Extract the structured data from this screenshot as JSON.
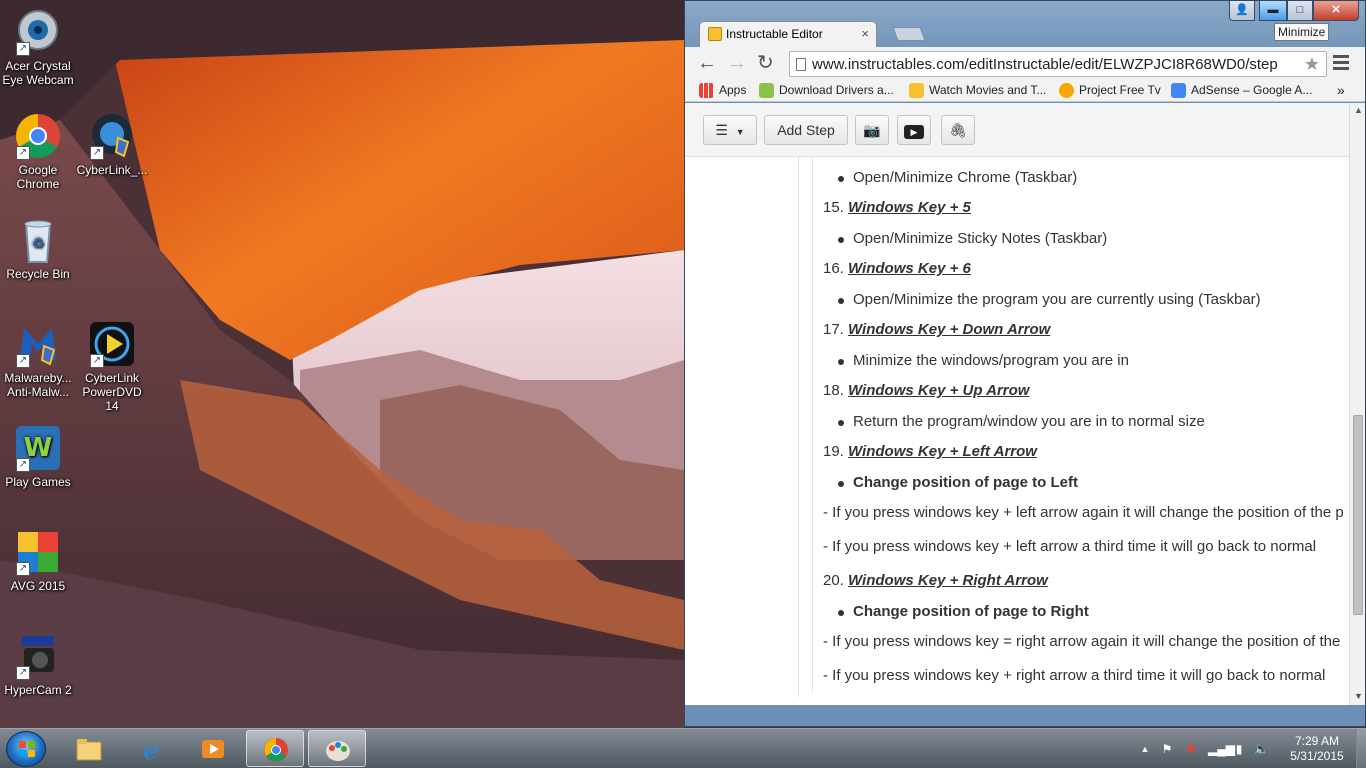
{
  "desktop": {
    "icons": [
      {
        "label": "Acer Crystal Eye Webcam"
      },
      {
        "label": "Google Chrome"
      },
      {
        "label": "CyberLink_..."
      },
      {
        "label": "Recycle Bin"
      },
      {
        "label": "Malwareby... Anti-Malw..."
      },
      {
        "label": "CyberLink PowerDVD 14"
      },
      {
        "label": "Play Games"
      },
      {
        "label": "AVG 2015"
      },
      {
        "label": "HyperCam 2"
      }
    ]
  },
  "browser": {
    "tab_title": "Instructable Editor",
    "tab_close": "×",
    "tooltip": "Minimize",
    "url": "www.instructables.com/editInstructable/edit/ELWZPJCI8R68WD0/step",
    "bookmarks": [
      {
        "label": "Apps",
        "color": "#e94235"
      },
      {
        "label": "Download Drivers a...",
        "color": "#8bc34a"
      },
      {
        "label": "Watch Movies and T...",
        "color": "#f6c12d"
      },
      {
        "label": "Project Free Tv",
        "color": "#f6a800"
      },
      {
        "label": "AdSense – Google A...",
        "color": "#4285f4"
      }
    ],
    "bookmarks_more": "»"
  },
  "editor": {
    "add_step_label": "Add Step",
    "lines": [
      {
        "type": "bullet",
        "text": "Open/Minimize Chrome (Taskbar)"
      },
      {
        "type": "num",
        "num": "15.",
        "text": "Windows Key + 5"
      },
      {
        "type": "bullet",
        "text": "Open/Minimize Sticky Notes (Taskbar)"
      },
      {
        "type": "num",
        "num": "16.",
        "text": "Windows Key + 6"
      },
      {
        "type": "bullet",
        "text": "Open/Minimize the program you are currently using (Taskbar)"
      },
      {
        "type": "num",
        "num": "17.",
        "text": "Windows Key + Down Arrow"
      },
      {
        "type": "bullet",
        "text": "Minimize the windows/program you are in"
      },
      {
        "type": "num",
        "num": "18.",
        "text": "Windows Key + Up Arrow"
      },
      {
        "type": "bullet",
        "text": "Return the program/window you are in to normal size"
      },
      {
        "type": "num",
        "num": "19.",
        "text": "Windows Key + Left Arrow"
      },
      {
        "type": "boldbullet",
        "text": "Change position of page to Left"
      },
      {
        "type": "dash",
        "text": "- If you press windows key + left arrow again it will change the position of the page"
      },
      {
        "type": "dash",
        "text": "- If you press windows key + left arrow a third time it will go back to normal"
      },
      {
        "type": "num",
        "num": "20.",
        "text": "Windows Key + Right Arrow"
      },
      {
        "type": "boldbullet",
        "text": "Change position of page to Right"
      },
      {
        "type": "dash",
        "text": "- If you press windows key = right arrow again it will change the position of the page"
      },
      {
        "type": "dash",
        "text": "- If you press windows key + right arrow a third time it will go back to normal"
      }
    ]
  },
  "taskbar": {
    "time": "7:29 AM",
    "date": "5/31/2015",
    "tray_expand": "▲"
  }
}
